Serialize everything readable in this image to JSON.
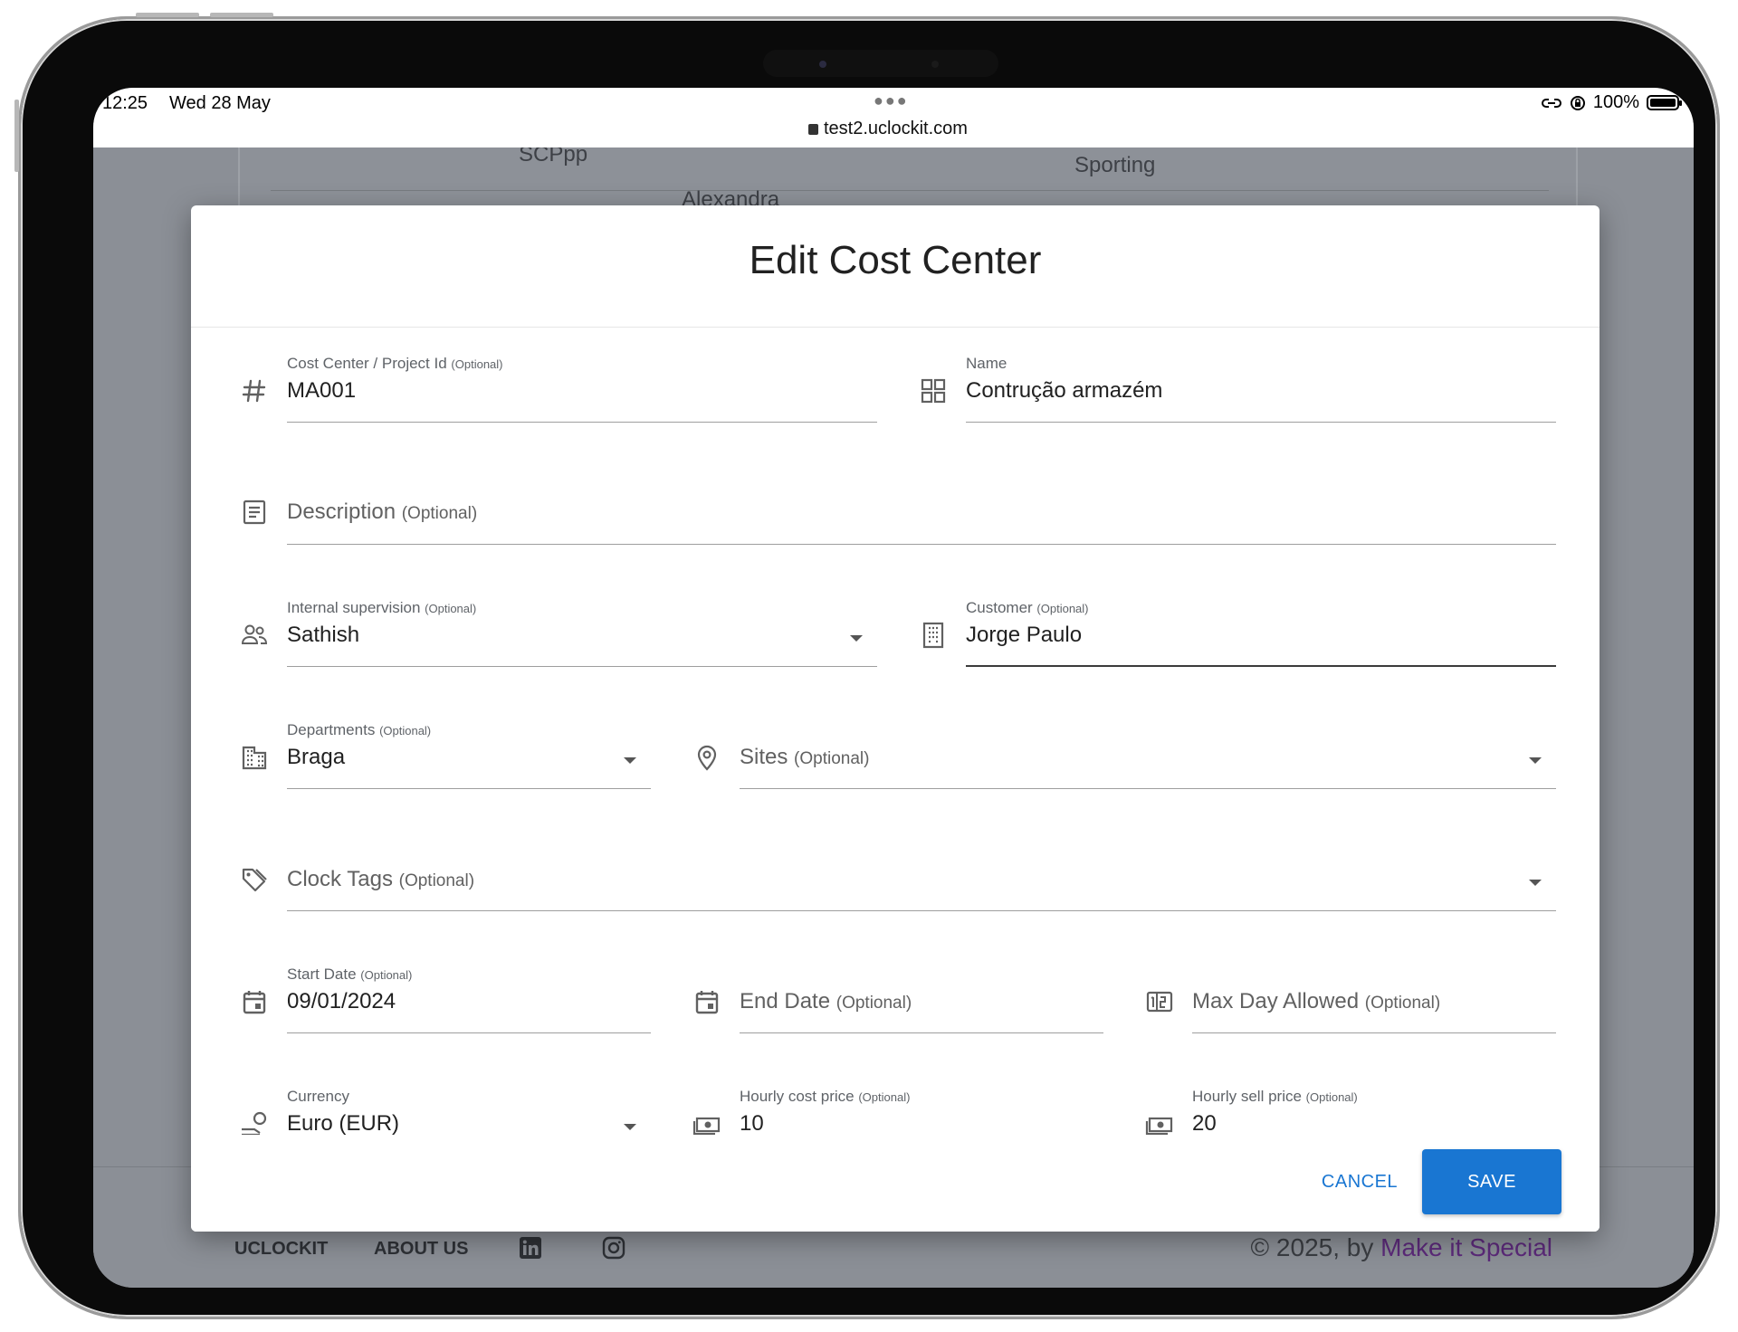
{
  "status_bar": {
    "time": "12:25",
    "date": "Wed 28 May",
    "url": "test2.uclockit.com",
    "battery": "100%",
    "battery_level": 1.0
  },
  "background_page": {
    "cells": [
      "SCPpp",
      "Sporting",
      "Alexandra"
    ],
    "footer": {
      "links": [
        "UCLOCKIT",
        "ABOUT US"
      ],
      "copyright_prefix": "© 2025, by ",
      "copyright_brand": "Make it Special"
    }
  },
  "modal": {
    "title": "Edit Cost Center",
    "fields": {
      "cost_center_id": {
        "label": "Cost Center / Project Id",
        "optional": "(Optional)",
        "value": "MA001"
      },
      "name": {
        "label": "Name",
        "value": "Contrução armazém"
      },
      "description": {
        "label": "Description",
        "optional": "(Optional)"
      },
      "internal_supervision": {
        "label": "Internal supervision",
        "optional": "(Optional)",
        "value": "Sathish"
      },
      "customer": {
        "label": "Customer",
        "optional": "(Optional)",
        "value": "Jorge Paulo"
      },
      "departments": {
        "label": "Departments",
        "optional": "(Optional)",
        "value": "Braga"
      },
      "sites": {
        "label": "Sites",
        "optional": "(Optional)"
      },
      "clock_tags": {
        "label": "Clock Tags",
        "optional": "(Optional)"
      },
      "start_date": {
        "label": "Start Date",
        "optional": "(Optional)",
        "value": "09/01/2024"
      },
      "end_date": {
        "label": "End Date",
        "optional": "(Optional)"
      },
      "max_day_allowed": {
        "label": "Max Day Allowed",
        "optional": "(Optional)"
      },
      "currency": {
        "label": "Currency",
        "value": "Euro (EUR)"
      },
      "hourly_cost_price": {
        "label": "Hourly cost price",
        "optional": "(Optional)",
        "value": "10"
      },
      "hourly_sell_price": {
        "label": "Hourly sell price",
        "optional": "(Optional)",
        "value": "20"
      }
    },
    "actions": {
      "cancel": "CANCEL",
      "save": "SAVE"
    },
    "colors": {
      "primary": "#1976d2",
      "text": "#212121",
      "overlay": "#8b8f96"
    }
  }
}
